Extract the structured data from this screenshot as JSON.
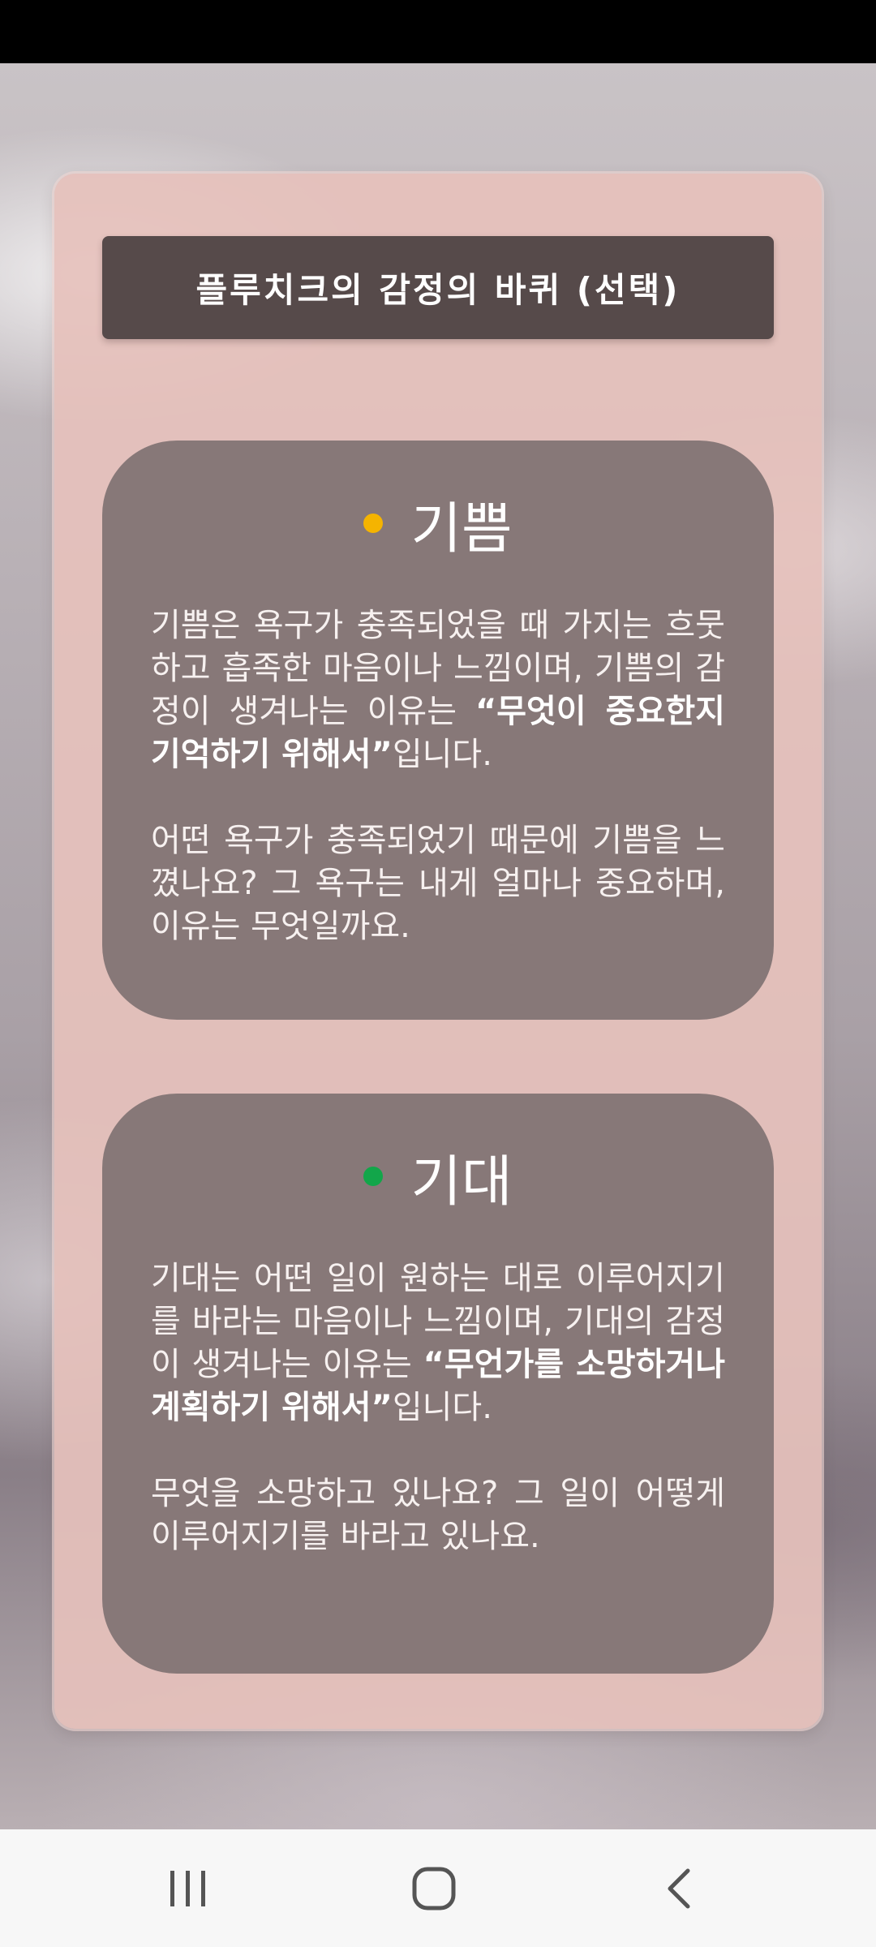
{
  "header": {
    "title": "플루치크의 감정의 바퀴 (선택)"
  },
  "cards": [
    {
      "title": "기쁨",
      "dot_color": "#f5b400",
      "p1_pre": "기쁨은 욕구가 충족되었을 때 가지는 흐뭇하고 흡족한 마음이나 느낌이며, 기쁨의 감정이 생겨나는 이유는 ",
      "p1_bold": "“무엇이 중요한지 기억하기 위해서”",
      "p1_post": "입니다.",
      "p2": "어떤 욕구가 충족되었기 때문에 기쁨을 느꼈나요? 그 욕구는 내게 얼마나 중요하며, 이유는 무엇일까요."
    },
    {
      "title": "기대",
      "dot_color": "#12a64a",
      "p1_pre": "기대는 어떤 일이 원하는 대로 이루어지기를 바라는 마음이나 느낌이며, 기대의 감정이 생겨나는 이유는 ",
      "p1_bold": "“무언가를 소망하거나 계획하기 위해서”",
      "p1_post": "입니다.",
      "p2": "무엇을 소망하고 있나요? 그 일이 어떻게 이루어지기를 바라고 있나요."
    }
  ],
  "nav": {
    "recent_icon": "recent-apps-icon",
    "home_icon": "home-icon",
    "back_icon": "back-icon"
  }
}
